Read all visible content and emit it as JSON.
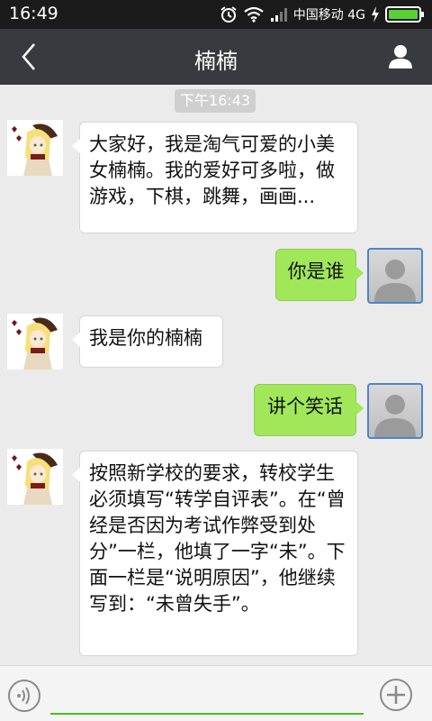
{
  "status_bar": {
    "time": "16:49",
    "carrier": "中国移动 4G",
    "icons": [
      "alarm-icon",
      "wifi-icon",
      "signal-icon",
      "charging-icon",
      "battery-icon"
    ]
  },
  "header": {
    "title": "楠楠",
    "back_icon": "chevron-left-icon",
    "profile_icon": "person-icon"
  },
  "chat": {
    "timestamp": "下午16:43",
    "messages": [
      {
        "from": "them",
        "text": "大家好，我是淘气可爱的小美女楠楠。我的爱好可多啦，做游戏，下棋，跳舞，画画..."
      },
      {
        "from": "me",
        "text": "你是谁"
      },
      {
        "from": "them",
        "text": "我是你的楠楠"
      },
      {
        "from": "me",
        "text": "讲个笑话"
      },
      {
        "from": "them",
        "text": "按照新学校的要求，转校学生必须填写“转学自评表”。在“曾经是否因为考试作弊受到处分”一栏，他填了一字“未”。下面一栏是“说明原因”，他继续写到：“未曾失手”。"
      }
    ]
  },
  "input_bar": {
    "value": "",
    "voice_icon": "voice-icon",
    "plus_icon": "plus-icon"
  },
  "colors": {
    "header_bg": "#393a3f",
    "chat_bg": "#ebebeb",
    "outgoing_bubble": "#a0e75a",
    "incoming_bubble": "#ffffff",
    "input_underline": "#45c01a"
  }
}
